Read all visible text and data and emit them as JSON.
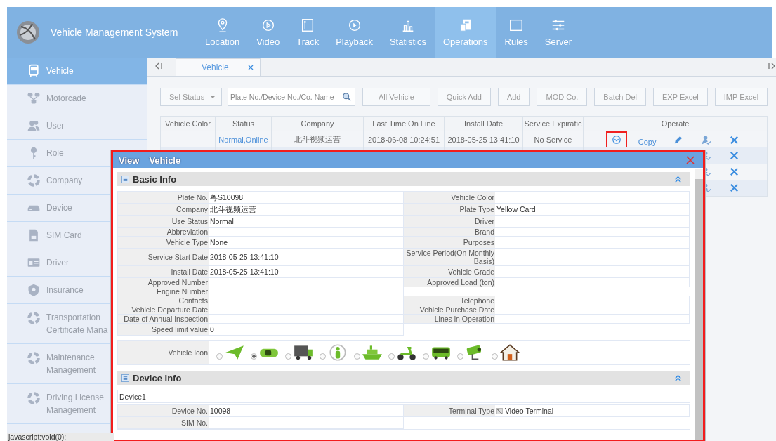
{
  "header": {
    "title": "Vehicle Management System",
    "nav": [
      {
        "label": "Location",
        "kind": "location",
        "selected": false
      },
      {
        "label": "Video",
        "kind": "video",
        "selected": false
      },
      {
        "label": "Track",
        "kind": "track",
        "selected": false
      },
      {
        "label": "Playback",
        "kind": "playback",
        "selected": false
      },
      {
        "label": "Statistics",
        "kind": "statistics",
        "selected": false
      },
      {
        "label": "Operations",
        "kind": "operations",
        "selected": true
      },
      {
        "label": "Rules",
        "kind": "rules",
        "selected": false
      },
      {
        "label": "Server",
        "kind": "server",
        "selected": false
      }
    ]
  },
  "sidebar": {
    "items": [
      {
        "label": "Vehicle",
        "kind": "bus",
        "selected": true
      },
      {
        "label": "Motorcade",
        "kind": "motorcade",
        "selected": false
      },
      {
        "label": "User",
        "kind": "user",
        "selected": false
      },
      {
        "label": "Role",
        "kind": "key",
        "selected": false
      },
      {
        "label": "Company",
        "kind": "ring",
        "selected": false
      },
      {
        "label": "Device",
        "kind": "device",
        "selected": false
      },
      {
        "label": "SIM Card",
        "kind": "sim",
        "selected": false
      },
      {
        "label": "Driver",
        "kind": "card",
        "selected": false
      },
      {
        "label": "Insurance",
        "kind": "shield",
        "selected": false
      },
      {
        "label": "Transportation Certificate Mana",
        "kind": "ring",
        "selected": false
      },
      {
        "label": "Maintenance Management",
        "kind": "ring",
        "selected": false
      },
      {
        "label": "Driving License Management",
        "kind": "ring",
        "selected": false
      }
    ]
  },
  "tabs": [
    {
      "label": "Vehicle",
      "selected": true
    }
  ],
  "toolbar": {
    "status_select": "Sel Status",
    "search": {
      "placeholder": "Plate No./Device No./Co. Name"
    },
    "buttons": [
      "All Vehicle",
      "Quick Add",
      "Add",
      "MOD Co.",
      "Batch Del",
      "EXP Excel",
      "IMP Excel"
    ]
  },
  "table": {
    "columns": [
      "Vehicle Color",
      "Status",
      "Company",
      "Last Time On Line",
      "Install Date",
      "Service Expiratic",
      "Operate"
    ],
    "rows": [
      {
        "status": "Normal,Online",
        "company": "北斗视频运营",
        "last_time": "2018-06-08 10:24:51",
        "install_date": "2018-05-25 13:41:10",
        "service_expiration": "No Service",
        "actions": [
          {
            "kind": "view",
            "highlighted": true
          },
          {
            "kind": "link",
            "label": "Copy"
          },
          {
            "kind": "edit"
          },
          {
            "kind": "assign"
          },
          {
            "kind": "delete"
          }
        ]
      },
      {
        "actions": [
          {
            "kind": "assign"
          },
          {
            "kind": "delete"
          }
        ]
      },
      {
        "actions": [
          {
            "kind": "assign"
          },
          {
            "kind": "delete"
          }
        ]
      },
      {
        "actions": [
          {
            "kind": "assign"
          },
          {
            "kind": "delete"
          }
        ]
      }
    ]
  },
  "dialog": {
    "title": "View",
    "subtitle": "Vehicle",
    "basic_info": {
      "title": "Basic Info",
      "rows": [
        {
          "left": {
            "label": "Plate No.",
            "value": "粤S10098"
          },
          "right": {
            "label": "Vehicle Color"
          }
        },
        {
          "left": {
            "label": "Company",
            "value": "北斗视频运营"
          },
          "right": {
            "label": "Plate Type",
            "value": "Yellow Card"
          }
        },
        {
          "left": {
            "label": "Use Status",
            "value": "Normal"
          },
          "right": {
            "label": "Driver"
          }
        },
        {
          "left": {
            "label": "Abbreviation"
          },
          "right": {
            "label": "Brand"
          }
        },
        {
          "left": {
            "label": "Vehicle Type",
            "value": "None"
          },
          "right": {
            "label": "Purposes"
          }
        },
        {
          "left": {
            "label": "Service Start Date",
            "value": "2018-05-25 13:41:10"
          },
          "right": {
            "label": "Service Period(On Monthly Basis)"
          }
        },
        {
          "left": {
            "label": "Install Date",
            "value": "2018-05-25 13:41:10"
          },
          "right": {
            "label": "Vehicle Grade"
          }
        },
        {
          "left": {
            "label": "Approved Number"
          },
          "right": {
            "label": "Approved Load (ton)"
          }
        },
        {
          "left": {
            "label": "Engine Number"
          }
        },
        {
          "left": {
            "label": "Contacts"
          },
          "right": {
            "label": "Telephone"
          }
        },
        {
          "left": {
            "label": "Vehicle Departure Date"
          },
          "right": {
            "label": "Vehicle Purchase Date"
          }
        },
        {
          "left": {
            "label": "Date of Annual Inspection"
          },
          "right": {
            "label": "Lines in Operation"
          }
        },
        {
          "left": {
            "label": "Speed limit value",
            "value": "0"
          }
        }
      ],
      "vehicle_icon": {
        "label": "Vehicle Icon",
        "options": [
          {
            "kind": "arrow",
            "selected": false
          },
          {
            "kind": "car",
            "selected": true
          },
          {
            "kind": "truck",
            "selected": false
          },
          {
            "kind": "person",
            "selected": false
          },
          {
            "kind": "ship",
            "selected": false
          },
          {
            "kind": "scooter",
            "selected": false
          },
          {
            "kind": "bus",
            "selected": false
          },
          {
            "kind": "camera",
            "selected": false
          },
          {
            "kind": "house",
            "selected": false
          }
        ]
      }
    },
    "device_info": {
      "title": "Device Info",
      "device_name": "Device1",
      "rows": [
        {
          "left": {
            "label": "Device No.",
            "value": "10098"
          },
          "right": {
            "label": "Terminal Type",
            "value": "Video Terminal",
            "checked": true
          }
        },
        {
          "left": {
            "label": "SIM No."
          }
        }
      ]
    }
  },
  "status_bar": "javascript:void(0);"
}
